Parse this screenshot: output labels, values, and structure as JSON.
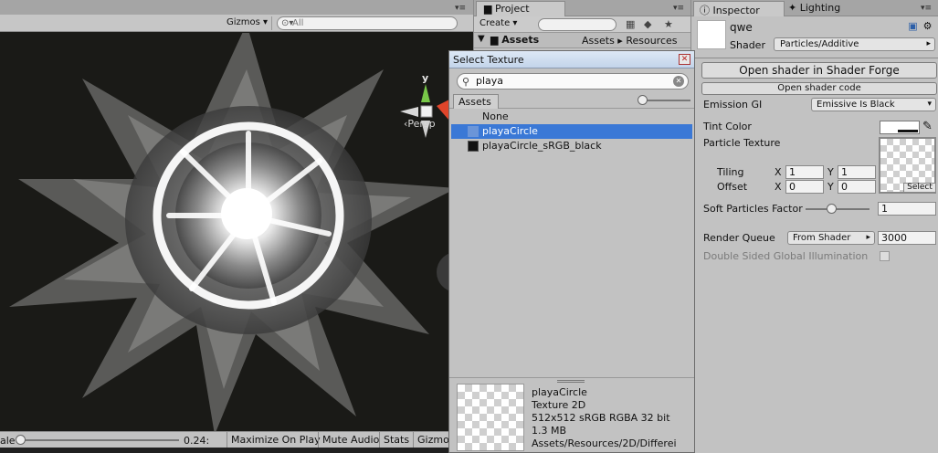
{
  "scene": {
    "gizmos_label": "Gizmos",
    "search_placeholder": "All",
    "persp_label": "Persp",
    "axis_y": "y",
    "scale_label": "ale",
    "scale_value": "0.24:",
    "bottom_buttons": [
      "Maximize On Play",
      "Mute Audio",
      "Stats",
      "Gizmo"
    ]
  },
  "project": {
    "tab_label": "Project",
    "create_label": "Create",
    "tree_root": "Assets",
    "breadcrumb": [
      "Assets",
      "Resources"
    ]
  },
  "dialog": {
    "title": "Select Texture",
    "search_value": "playa",
    "assets_tab": "Assets",
    "items": [
      {
        "label": "None",
        "selected": false
      },
      {
        "label": "playaCircle",
        "selected": true
      },
      {
        "label": "playaCircle_sRGB_black",
        "selected": false
      }
    ],
    "preview_info": [
      "playaCircle",
      "Texture 2D",
      "512x512 sRGB  RGBA 32 bit",
      "1.3 MB",
      "Assets/Resources/2D/Differei"
    ]
  },
  "inspector": {
    "tab_label": "Inspector",
    "lighting_tab": "Lighting",
    "material_name": "qwe",
    "shader_label": "Shader",
    "shader_value": "Particles/Additive",
    "open_shader_forge": "Open shader in Shader Forge",
    "open_shader_code": "Open shader code",
    "emission_gi_label": "Emission GI",
    "emission_gi_value": "Emissive Is Black",
    "tint_color_label": "Tint Color",
    "particle_texture_label": "Particle Texture",
    "tiling_label": "Tiling",
    "offset_label": "Offset",
    "x_label": "X",
    "y_label": "Y",
    "tiling_x": "1",
    "tiling_y": "1",
    "offset_x": "0",
    "offset_y": "0",
    "select_label": "Select",
    "soft_particles_label": "Soft Particles Factor",
    "soft_particles_value": "1",
    "render_queue_label": "Render Queue",
    "render_queue_mode": "From Shader",
    "render_queue_value": "3000",
    "dsgi_label": "Double Sided Global Illumination"
  },
  "colors": {
    "selection": "#3a78d6",
    "panel_bg": "#c2c2c2",
    "scene_bg": "#1a1a17"
  }
}
